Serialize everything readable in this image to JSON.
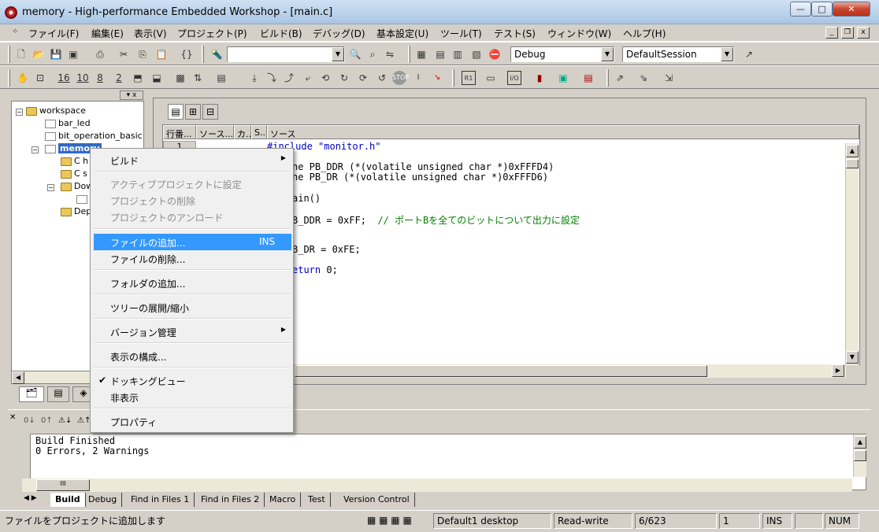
{
  "window": {
    "title": "memory - High-performance Embedded Workshop - [main.c]",
    "controls": {
      "minimize": "—",
      "maximize": "□",
      "close": "✕"
    }
  },
  "menubar": {
    "items": [
      "ファイル(F)",
      "編集(E)",
      "表示(V)",
      "プロジェクト(P)",
      "ビルド(B)",
      "デバッグ(D)",
      "基本設定(U)",
      "ツール(T)",
      "テスト(S)",
      "ウィンドウ(W)",
      "ヘルプ(H)"
    ],
    "mdi": {
      "minimize": "_",
      "restore": "❐",
      "close": "x"
    }
  },
  "toolbar": {
    "config_combo": "Debug",
    "session_combo": "DefaultSession",
    "find_combo": "",
    "labels": {
      "b16": "16",
      "b10": "10",
      "b8": "8",
      "b2": "2"
    }
  },
  "workspace": {
    "root": "workspace",
    "items": [
      "bar_led",
      "bit_operation_basic",
      "memory",
      "C h",
      "C s",
      "Dow",
      "Dep"
    ]
  },
  "editor": {
    "toolbar_icons": [
      "doc-icon",
      "source-icon",
      "mixed-icon"
    ],
    "columns": [
      "行番...",
      "ソース...",
      "カ...",
      "S...",
      "ソース"
    ],
    "line_number": "1",
    "code": {
      "line1": "#include \"monitor.h\"",
      "line3": "ne PB_DDR (*(volatile unsigned char *)0xFFFD4)",
      "line4": "ne PB_DR (*(volatile unsigned char *)0xFFFD6)",
      "line6": "ain()",
      "line8_code": "B_DDR = 0xFF;  ",
      "line8_comment": "// ポートBを全てのビットについて出力に設定",
      "line11": "B_DR = 0xFE;",
      "line13_kw": "eturn",
      "line13_rest": " 0;"
    }
  },
  "context_menu": {
    "build": "ビルド",
    "set_active": "アクティブプロジェクトに設定",
    "delete_project": "プロジェクトの削除",
    "unload_project": "プロジェクトのアンロード",
    "add_file": "ファイルの追加...",
    "add_file_shortcut": "INS",
    "remove_file": "ファイルの削除...",
    "add_folder": "フォルダの追加...",
    "expand_tree": "ツリーの展開/縮小",
    "version_control": "バージョン管理",
    "configure_view": "表示の構成...",
    "docking_view": "ドッキングビュー",
    "hide": "非表示",
    "properties": "プロパティ"
  },
  "output": {
    "lines": [
      "Build Finished",
      "0 Errors, 2 Warnings"
    ],
    "tabs": [
      "Build",
      "Debug",
      "Find in Files 1",
      "Find in Files 2",
      "Macro",
      "Test",
      "Version Control"
    ]
  },
  "statusbar": {
    "message": "ファイルをプロジェクトに追加します",
    "desktop": "Default1 desktop",
    "mode": "Read-write",
    "position": "6/623",
    "column": "1",
    "ins": "INS",
    "num": "NUM"
  }
}
